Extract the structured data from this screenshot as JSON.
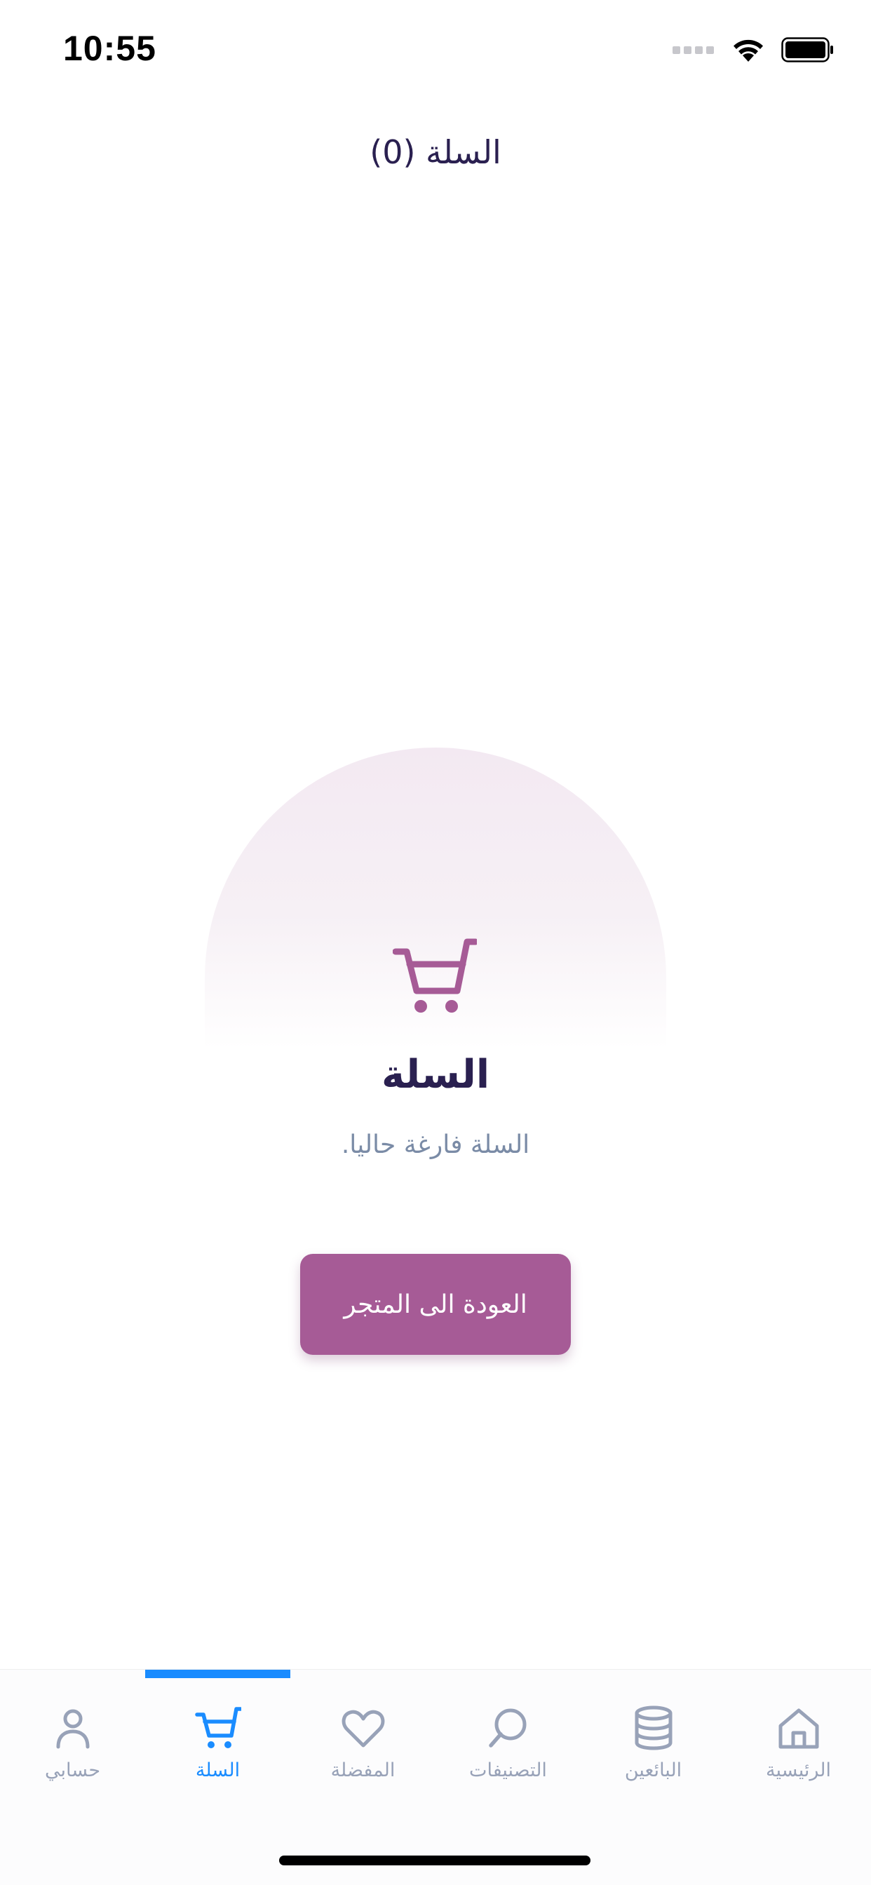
{
  "status_bar": {
    "time": "10:55"
  },
  "header": {
    "title": "السلة (0)"
  },
  "empty_state": {
    "icon": "cart-icon",
    "title": "السلة",
    "subtitle": "السلة فارغة حاليا.",
    "button_label": "العودة الى المتجر"
  },
  "tab_bar": {
    "active_tab": "السلة",
    "tabs": [
      {
        "label": "حسابي",
        "icon": "user-icon"
      },
      {
        "label": "السلة",
        "icon": "cart-icon"
      },
      {
        "label": "المفضلة",
        "icon": "heart-icon"
      },
      {
        "label": "التصنيفات",
        "icon": "search-icon"
      },
      {
        "label": "البائعين",
        "icon": "database-icon"
      },
      {
        "label": "الرئيسية",
        "icon": "home-icon"
      }
    ]
  },
  "colors": {
    "primary": "#a65b96",
    "text_dark": "#2a2050",
    "text_muted": "#7a8ba6",
    "tab_active": "#1a8cff",
    "tab_inactive": "#98a2b8"
  }
}
